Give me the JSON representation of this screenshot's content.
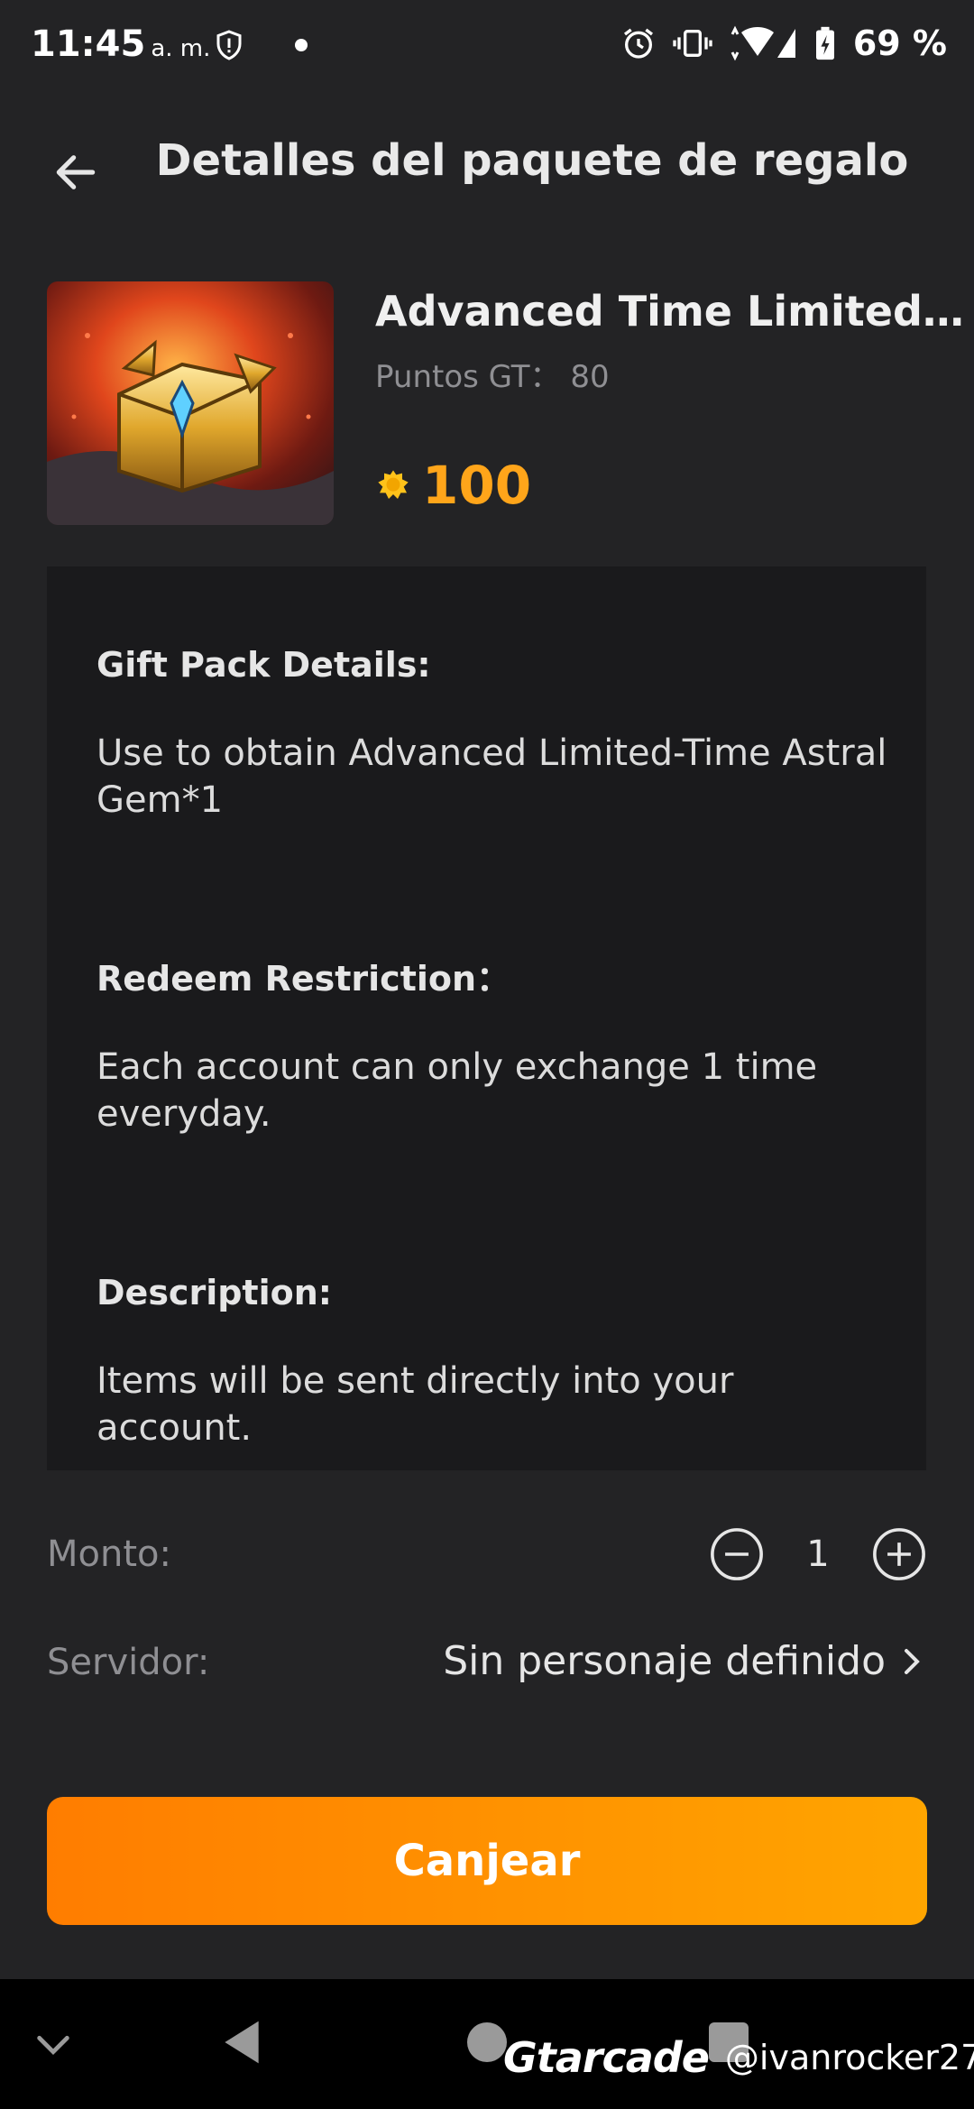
{
  "status_bar": {
    "time": "11:45",
    "ampm": "a. m.",
    "battery": "69 %"
  },
  "header": {
    "title": "Detalles del paquete de regalo"
  },
  "product": {
    "title": "Advanced Time Limited A...",
    "points": "Puntos GT： 80",
    "price": "100"
  },
  "details": {
    "gift_heading": "Gift Pack Details:",
    "gift_text": "Use to obtain Advanced Limited-Time Astral Gem*1",
    "restriction_heading": "Redeem Restriction：",
    "restriction_text": "Each account can only exchange 1 time everyday.",
    "description_heading": "Description:",
    "description_text": "Items will be sent directly into your account."
  },
  "amount": {
    "label": "Monto:",
    "value": "1"
  },
  "server": {
    "label": "Servidor:",
    "value": "Sin personaje definido"
  },
  "redeem_button": "Canjear",
  "watermark": {
    "logo": "Gtarcade",
    "user": "@ivanrocker27"
  },
  "colors": {
    "accent": "#ffa51a",
    "button_start": "#ff7d00",
    "button_end": "#ffa500",
    "background": "#232325",
    "panel": "#1a1a1c"
  }
}
